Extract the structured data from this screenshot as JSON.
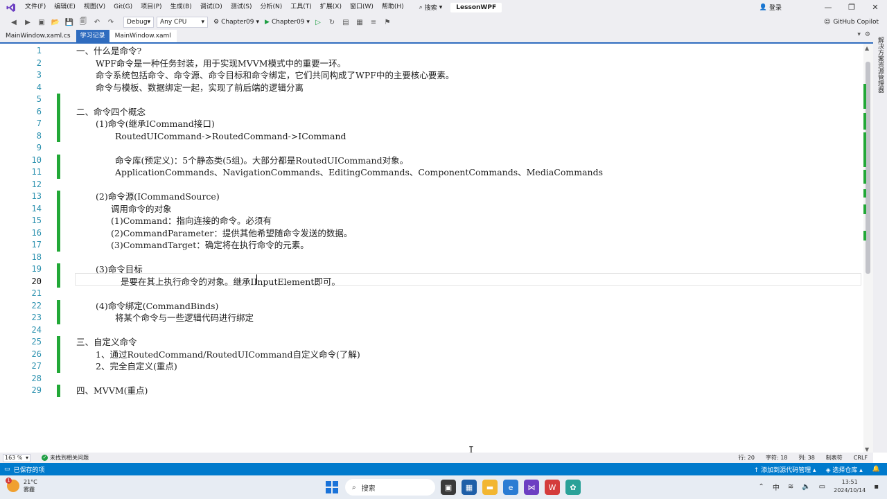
{
  "menu": {
    "items": [
      "文件(F)",
      "编辑(E)",
      "视图(V)",
      "Git(G)",
      "项目(P)",
      "生成(B)",
      "调试(D)",
      "测试(S)",
      "分析(N)",
      "工具(T)",
      "扩展(X)",
      "窗口(W)",
      "帮助(H)"
    ],
    "search_label": "搜索",
    "solution_name": "LessonWPF",
    "login_label": "登录"
  },
  "toolbar": {
    "config": "Debug",
    "platform": "Any CPU",
    "project": "Chapter09",
    "run_target": "Chapter09",
    "copilot_label": "GitHub Copilot"
  },
  "tabs": {
    "items": [
      "MainWindow.xaml.cs",
      "MainWindow.xaml"
    ],
    "overlay": "学习记录"
  },
  "side_strip_label": "解决方案资源管理器",
  "editor": {
    "current_line": 20,
    "lines": [
      {
        "no": "1",
        "text": "一、什么是命令?",
        "indent": 0,
        "changed": false
      },
      {
        "no": "2",
        "text": "WPF命令是一种任务封装，用于实现MVVM模式中的重要一环。",
        "indent": 1,
        "changed": false
      },
      {
        "no": "3",
        "text": "命令系统包括命令、命令源、命令目标和命令绑定，它们共同构成了WPF中的主要核心要素。",
        "indent": 1,
        "changed": false
      },
      {
        "no": "4",
        "text": "命令与模板、数据绑定一起，实现了前后端的逻辑分离",
        "indent": 1,
        "changed": false
      },
      {
        "no": "5",
        "text": "",
        "indent": 0,
        "changed": true
      },
      {
        "no": "6",
        "text": "二、命令四个概念",
        "indent": 0,
        "changed": true
      },
      {
        "no": "7",
        "text": "(1)命令(继承ICommand接口)",
        "indent": 1,
        "changed": true
      },
      {
        "no": "8",
        "text": "RoutedUICommand->RoutedCommand->ICommand",
        "indent": 2,
        "changed": true
      },
      {
        "no": "9",
        "text": "",
        "indent": 0,
        "changed": false
      },
      {
        "no": "10",
        "text": "命令库(预定义)：5个静态类(5组)。大部分都是RoutedUICommand对象。",
        "indent": 2,
        "changed": true
      },
      {
        "no": "11",
        "text": "ApplicationCommands、NavigationCommands、EditingCommands、ComponentCommands、MediaCommands",
        "indent": 2,
        "changed": true
      },
      {
        "no": "12",
        "text": "",
        "indent": 0,
        "changed": false
      },
      {
        "no": "13",
        "text": "(2)命令源(ICommandSource)",
        "indent": 1,
        "changed": true
      },
      {
        "no": "14",
        "text": "调用命令的对象",
        "indent": 3,
        "changed": true
      },
      {
        "no": "15",
        "text": "(1)Command：指向连接的命令。必须有",
        "indent": 3,
        "changed": true
      },
      {
        "no": "16",
        "text": "(2)CommandParameter：提供其他希望随命令发送的数据。",
        "indent": 3,
        "changed": true
      },
      {
        "no": "17",
        "text": "(3)CommandTarget：确定将在执行命令的元素。",
        "indent": 3,
        "changed": true
      },
      {
        "no": "18",
        "text": "",
        "indent": 0,
        "changed": false
      },
      {
        "no": "19",
        "text": "(3)命令目标",
        "indent": 1,
        "changed": true
      },
      {
        "no": "20",
        "text": "是要在其上执行命令的对象。继承IInputElement即可。",
        "indent": 4,
        "changed": true
      },
      {
        "no": "21",
        "text": "",
        "indent": 0,
        "changed": false
      },
      {
        "no": "22",
        "text": "(4)命令绑定(CommandBinds)",
        "indent": 1,
        "changed": true
      },
      {
        "no": "23",
        "text": "将某个命令与一些逻辑代码进行绑定",
        "indent": 2,
        "changed": true
      },
      {
        "no": "24",
        "text": "",
        "indent": 0,
        "changed": false
      },
      {
        "no": "25",
        "text": "三、自定义命令",
        "indent": 0,
        "changed": true
      },
      {
        "no": "26",
        "text": "1、通过RoutedCommand/RoutedUICommand自定义命令(了解)",
        "indent": 1,
        "changed": true
      },
      {
        "no": "27",
        "text": "2、完全自定义(重点)",
        "indent": 1,
        "changed": true
      },
      {
        "no": "28",
        "text": "",
        "indent": 0,
        "changed": false
      },
      {
        "no": "29",
        "text": "四、MVVM(重点)",
        "indent": 0,
        "changed": true
      }
    ]
  },
  "editor_status": {
    "zoom": "163 %",
    "issues": "未找到相关问题",
    "line": "行: 20",
    "char": "字符: 18",
    "col": "列: 38",
    "tab_mode": "制表符",
    "eol": "CRLF"
  },
  "statusbar": {
    "saved": "已保存的项",
    "add_source": "添加到源代码管理",
    "select_repo": "选择仓库"
  },
  "taskbar": {
    "temperature": "21°C",
    "weather": "雾霾",
    "weather_badge": "1",
    "search": "搜索",
    "time": "13:51",
    "date": "2024/10/14"
  },
  "colors": {
    "accent": "#007acc",
    "change_bar": "#22a837",
    "line_number": "#2b91af"
  }
}
